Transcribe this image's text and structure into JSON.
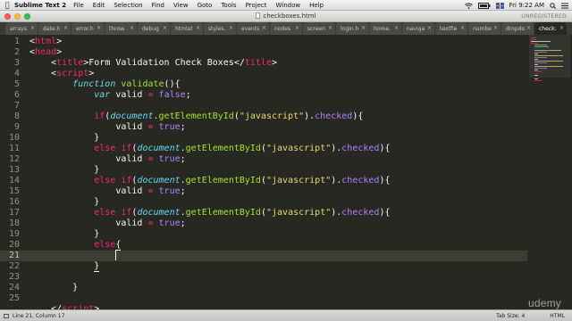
{
  "menubar": {
    "app_name": "Sublime Text 2",
    "items": [
      "File",
      "Edit",
      "Selection",
      "Find",
      "View",
      "Goto",
      "Tools",
      "Project",
      "Window",
      "Help"
    ],
    "clock": "Fri 9:22 AM"
  },
  "window": {
    "title": "checkboxes.html",
    "unregistered": "UNREGISTERED"
  },
  "tabs": [
    {
      "label": "arrays"
    },
    {
      "label": "date.h"
    },
    {
      "label": "error.h"
    },
    {
      "label": "throw."
    },
    {
      "label": "debug"
    },
    {
      "label": "htmlat"
    },
    {
      "label": "styles."
    },
    {
      "label": "events"
    },
    {
      "label": "nodes"
    },
    {
      "label": "screen"
    },
    {
      "label": "login.h"
    },
    {
      "label": "home."
    },
    {
      "label": "naviga"
    },
    {
      "label": "textfie"
    },
    {
      "label": "numbe"
    },
    {
      "label": "dropdo"
    },
    {
      "label": "check:",
      "active": true
    }
  ],
  "editor": {
    "lines": [
      "1",
      "2",
      "3",
      "4",
      "5",
      "6",
      "7",
      "8",
      "9",
      "10",
      "11",
      "12",
      "13",
      "14",
      "15",
      "16",
      "17",
      "18",
      "19",
      "20",
      "21",
      "22",
      "23",
      "24",
      "25"
    ],
    "strings": {
      "html": "html",
      "head": "head",
      "title_tag": "title",
      "title_text": "Form Validation Check Boxes",
      "script": "script",
      "function_kw": "function",
      "fn_name": "validate",
      "var_kw": "var",
      "var_name": "valid",
      "false_val": "false",
      "true_val": "true",
      "if_kw": "if",
      "else_kw": "else",
      "document": "document",
      "method": "getElementById",
      "arg": "\"javascript\"",
      "prop": "checked"
    }
  },
  "status": {
    "position": "Line 21, Column 17",
    "tab_size": "Tab Size: 4",
    "syntax": "HTML"
  },
  "watermark": "udemy",
  "colors": {
    "background": "#272822",
    "tag": "#f92672",
    "function": "#a6e22e",
    "string": "#e6db74",
    "constant": "#ae81ff",
    "storage": "#66d9ef"
  }
}
